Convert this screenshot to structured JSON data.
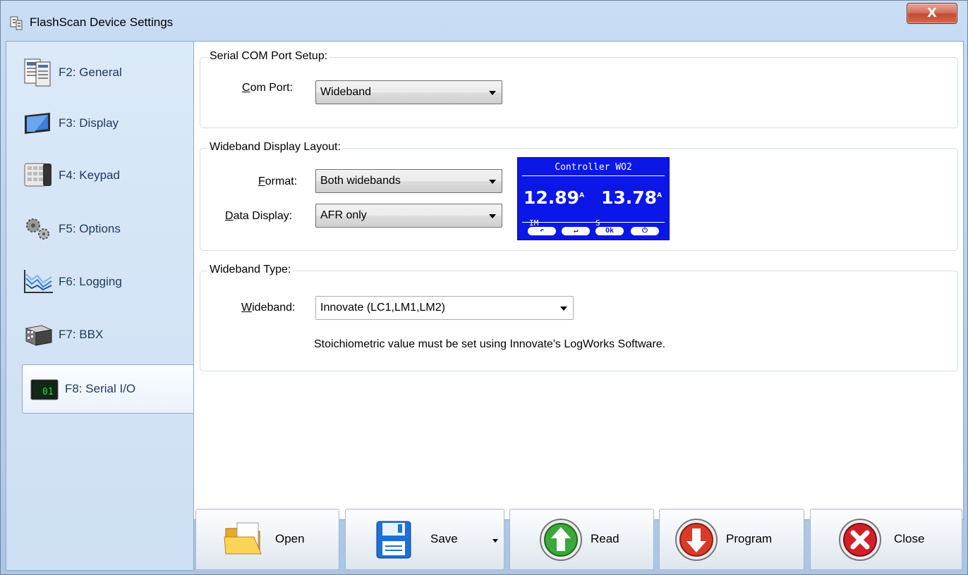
{
  "window": {
    "title": "FlashScan Device Settings",
    "close_glyph": "X"
  },
  "sidebar": {
    "items": [
      {
        "label": "F2: General",
        "icon": "general-icon"
      },
      {
        "label": "F3: Display",
        "icon": "display-icon"
      },
      {
        "label": "F4: Keypad",
        "icon": "keypad-icon"
      },
      {
        "label": "F5: Options",
        "icon": "options-icon"
      },
      {
        "label": "F6: Logging",
        "icon": "logging-icon"
      },
      {
        "label": "F7: BBX",
        "icon": "bbx-icon"
      },
      {
        "label": "F8: Serial I/O",
        "icon": "serial-io-icon",
        "selected": true
      }
    ]
  },
  "serial_com": {
    "title": "Serial COM Port Setup:",
    "com_port_label_prefix": "C",
    "com_port_label_rest": "om Port:",
    "com_port_value": "Wideband"
  },
  "display_layout": {
    "title": "Wideband Display Layout:",
    "format_label_prefix": "F",
    "format_label_rest": "ormat:",
    "format_value": "Both widebands",
    "data_display_label_prefix": "D",
    "data_display_label_rest": "ata Display:",
    "data_display_value": "AFR only",
    "preview": {
      "title": "Controller WO2",
      "value1": "12.89",
      "value2": "13.78",
      "unit_top": "A",
      "unit_bottom": "F",
      "unit_sub": "R",
      "left_tag": "IM",
      "mid_tag": "S",
      "buttons": [
        "↶",
        "↵",
        "Ok",
        "⏻"
      ]
    }
  },
  "wideband_type": {
    "title": "Wideband Type:",
    "wideband_label_prefix": "W",
    "wideband_label_rest": "ideband:",
    "wideband_value": "Innovate (LC1,LM1,LM2)",
    "note": "Stoichiometric value must be set using Innovate's LogWorks Software."
  },
  "toolbar": {
    "open": "Open",
    "save": "Save",
    "read": "Read",
    "program": "Program",
    "close": "Close"
  },
  "colors": {
    "lcd_background": "#0a17e6",
    "read_green": "#3aa83a",
    "program_red": "#d93b2b",
    "close_red": "#d21f2a"
  }
}
